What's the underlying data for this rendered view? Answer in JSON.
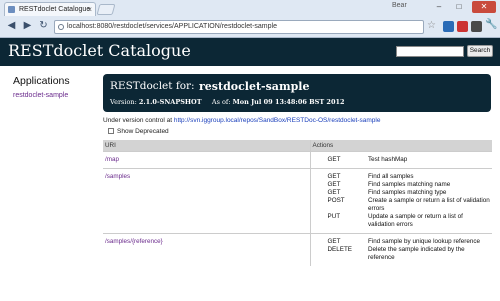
{
  "browser": {
    "tab_title": "RESTdoclet Catalogue",
    "url": "localhost:8080/restdoclet/services/APPLICATION/restdoclet-sample",
    "window_label": "Bear"
  },
  "header": {
    "title": "RESTdoclet Catalogue",
    "search_button": "Search",
    "search_value": ""
  },
  "sidebar": {
    "title": "Applications",
    "link": "restdoclet-sample"
  },
  "banner": {
    "label": "RESTdoclet for:",
    "name": "restdoclet-sample",
    "version_label": "Version:",
    "version_value": "2.1.0-SNAPSHOT",
    "asof_label": "As of:",
    "asof_value": "Mon Jul 09 13:48:06 BST 2012"
  },
  "version_control": {
    "prefix": "Under version control at",
    "url": "http://svn.iggroup.local/repos/SandBox/RESTDoc-OS/restdoclet-sample"
  },
  "show_deprecated": "Show Deprecated",
  "table": {
    "headers": [
      "URI",
      "Actions"
    ],
    "groups": [
      {
        "uri": "/map",
        "actions": [
          {
            "method": "GET",
            "description": "Test hashMap"
          }
        ]
      },
      {
        "uri": "/samples",
        "actions": [
          {
            "method": "GET",
            "description": "Find all samples"
          },
          {
            "method": "GET",
            "description": "Find samples matching name"
          },
          {
            "method": "GET",
            "description": "Find samples matching type"
          },
          {
            "method": "POST",
            "description": "Create a sample or return a list of validation errors"
          },
          {
            "method": "PUT",
            "description": "Update a sample or return a list of validation errors"
          }
        ]
      },
      {
        "uri": "/samples/{reference}",
        "actions": [
          {
            "method": "GET",
            "description": "Find sample by unique lookup reference"
          },
          {
            "method": "DELETE",
            "description": "Delete the sample indicated by the reference"
          }
        ]
      }
    ]
  }
}
